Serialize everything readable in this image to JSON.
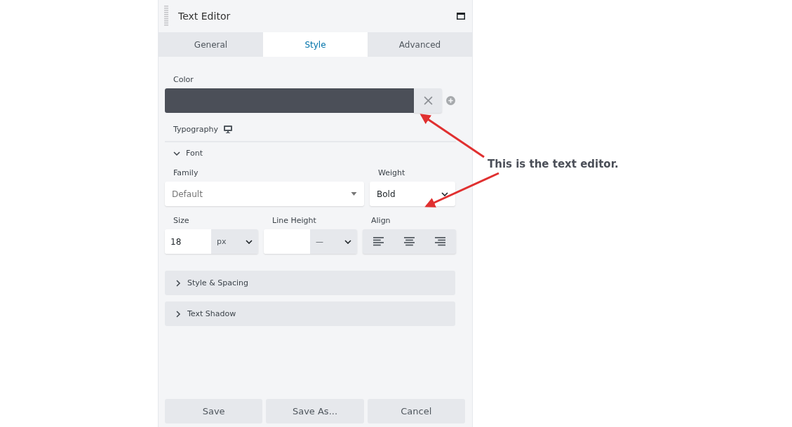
{
  "panel": {
    "title": "Text Editor"
  },
  "tabs": [
    {
      "label": "General",
      "selected": false
    },
    {
      "label": "Style",
      "selected": true
    },
    {
      "label": "Advanced",
      "selected": false
    }
  ],
  "color_field": {
    "label": "Color",
    "color": "#4b4f58"
  },
  "typography": {
    "label": "Typography"
  },
  "font_section": {
    "label": "Font",
    "expanded": true
  },
  "family": {
    "label": "Family",
    "placeholder": "Default"
  },
  "weight": {
    "label": "Weight",
    "value": "Bold"
  },
  "size": {
    "label": "Size",
    "value": "18",
    "unit": "px"
  },
  "line_height": {
    "label": "Line Height",
    "unit": "—"
  },
  "align": {
    "label": "Align",
    "options": [
      {
        "kind": "left"
      },
      {
        "kind": "center"
      },
      {
        "kind": "right"
      }
    ]
  },
  "sections": [
    {
      "label": "Style & Spacing",
      "expanded": false
    },
    {
      "label": "Text Shadow",
      "expanded": false
    }
  ],
  "buttons": [
    "Save",
    "Save As...",
    "Cancel"
  ],
  "annotation": {
    "text": "This is the text editor."
  }
}
